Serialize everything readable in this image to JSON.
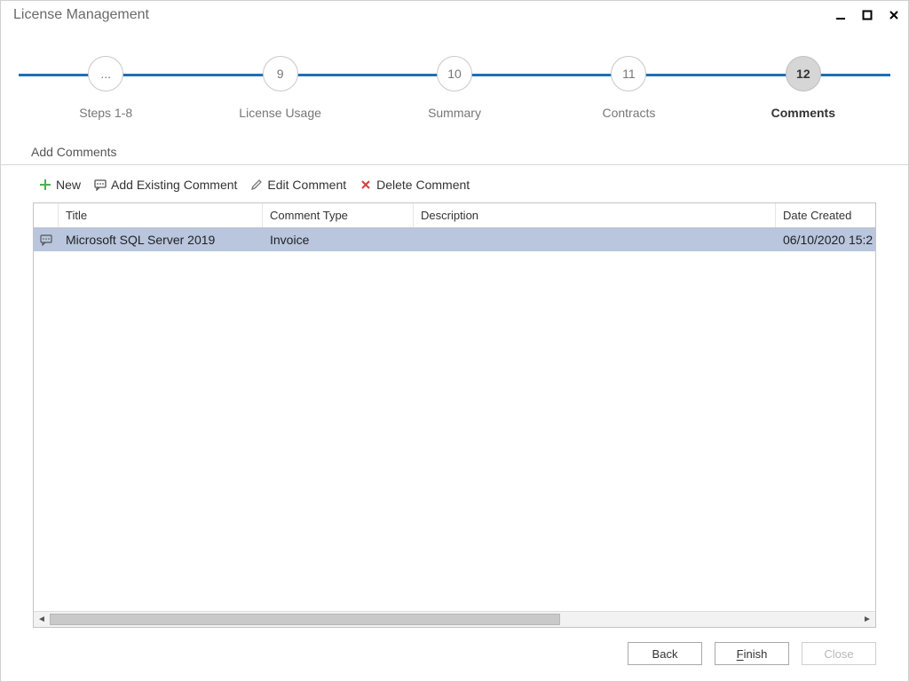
{
  "window": {
    "title": "License Management"
  },
  "stepper": {
    "steps": [
      {
        "badge": "...",
        "label": "Steps 1-8"
      },
      {
        "badge": "9",
        "label": "License Usage"
      },
      {
        "badge": "10",
        "label": "Summary"
      },
      {
        "badge": "11",
        "label": "Contracts"
      },
      {
        "badge": "12",
        "label": "Comments"
      }
    ],
    "current_index": 4
  },
  "section": {
    "heading": "Add Comments"
  },
  "toolbar": {
    "new_label": "New",
    "add_existing_label": "Add Existing Comment",
    "edit_label": "Edit Comment",
    "delete_label": "Delete Comment"
  },
  "grid": {
    "columns": {
      "title": "Title",
      "comment_type": "Comment Type",
      "description": "Description",
      "date_created": "Date Created"
    },
    "rows": [
      {
        "title": "Microsoft SQL Server 2019",
        "comment_type": "Invoice",
        "description": "",
        "date_created": "06/10/2020 15:2",
        "selected": true
      }
    ]
  },
  "footer": {
    "back_label": "Back",
    "finish_label_prefix": "",
    "finish_mnemonic": "F",
    "finish_label_suffix": "inish",
    "close_label": "Close"
  },
  "icons": {
    "plus_color": "#4caf50",
    "delete_color": "#d83b3b",
    "pencil_color": "#777",
    "comment_color": "#555"
  }
}
